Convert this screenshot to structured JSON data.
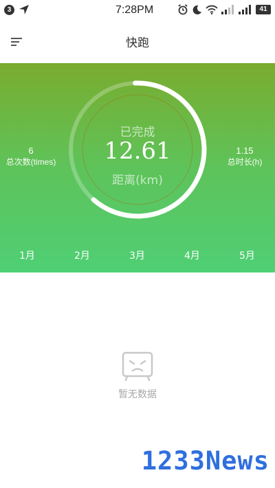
{
  "status_bar": {
    "notification_count": "3",
    "time": "7:28PM",
    "battery": "41",
    "icons": [
      "navigation-arrow-icon",
      "alarm-icon",
      "moon-icon",
      "wifi-icon",
      "signal-icon",
      "signal-icon",
      "battery-icon"
    ]
  },
  "header": {
    "title": "快跑",
    "menu_icon": "menu-icon"
  },
  "summary": {
    "status_label": "已完成",
    "distance_value": "12.61",
    "distance_label": "距离(km)",
    "progress": 0.62,
    "total_times_value": "6",
    "total_times_label": "总次数(times)",
    "total_hours_value": "1.15",
    "total_hours_label": "总时长(h)"
  },
  "months": [
    "1月",
    "2月",
    "3月",
    "4月",
    "5月"
  ],
  "empty_state": {
    "icon": "empty-face-icon",
    "text": "暂无数据"
  },
  "watermark": "1233News",
  "colors": {
    "hero_top": "#7aac2e",
    "hero_bottom": "#4fcf75",
    "watermark": "#2f6fde"
  }
}
